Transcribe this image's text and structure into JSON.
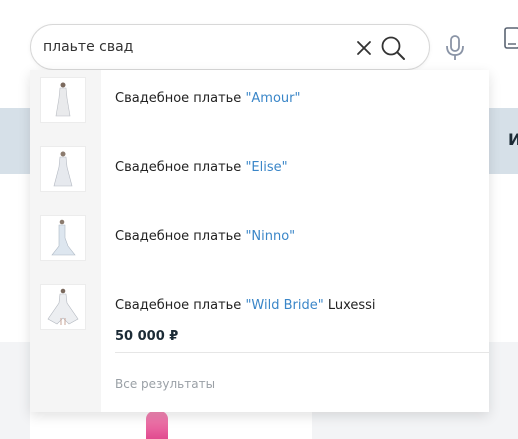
{
  "search": {
    "value": "плaьте свад",
    "clear_icon": "close-icon",
    "search_icon": "search-icon",
    "mic_icon": "microphone-icon"
  },
  "header": {
    "device_icon": "mobile-phone-icon"
  },
  "background": {
    "band_label": "И"
  },
  "suggestions": [
    {
      "prefix": "Свадебное платье ",
      "highlight": "\"Amour\"",
      "suffix": ""
    },
    {
      "prefix": "Свадебное платье ",
      "highlight": "\"Elise\"",
      "suffix": ""
    },
    {
      "prefix": "Свадебное платье ",
      "highlight": "\"Ninno\"",
      "suffix": ""
    },
    {
      "prefix": "Свадебное платье ",
      "highlight": "\"Wild Bride\"",
      "suffix": " Luxessi",
      "price": "50 000 ₽"
    }
  ],
  "all_results_label": "Все результаты",
  "colors": {
    "highlight": "#3a86c8",
    "band": "#d6e0e8",
    "thumb_column": "#f5f5f5"
  }
}
